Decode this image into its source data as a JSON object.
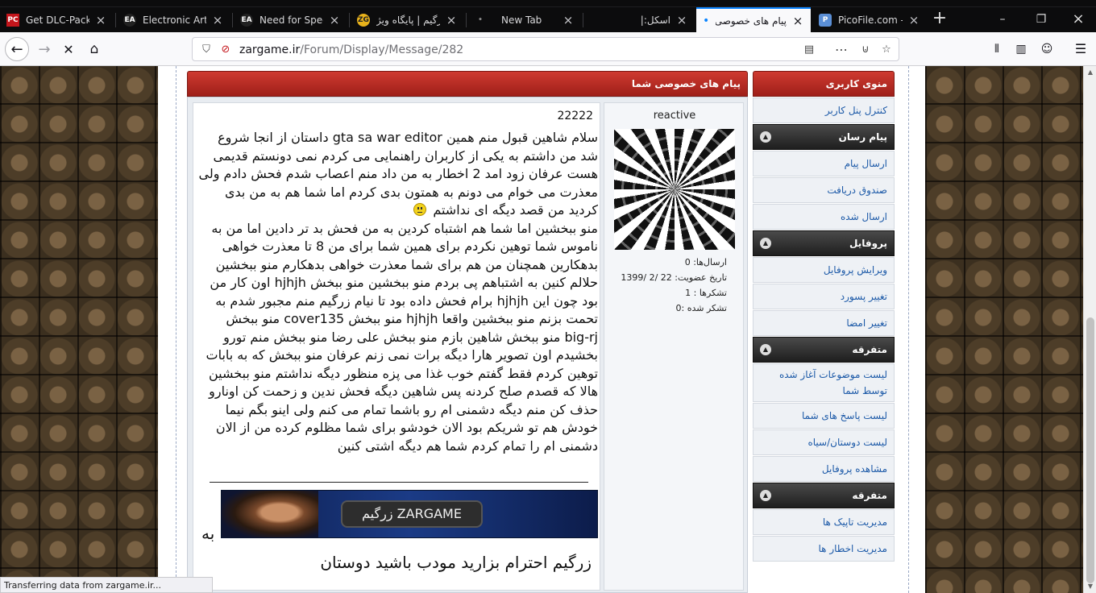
{
  "browser": {
    "tabs": [
      {
        "title": "Get DLC-Packed",
        "icon": "pc-icon",
        "icon_text": "PC"
      },
      {
        "title": "Electronic Arts",
        "icon": "ea-icon",
        "icon_text": "EA"
      },
      {
        "title": "Need for Speed",
        "icon": "ea-icon",
        "icon_text": "EA"
      },
      {
        "title": "زرگیم | پایگاه ویژ",
        "icon": "zargame-icon",
        "icon_text": "ZG"
      },
      {
        "title": "New Tab",
        "icon": "dot-icon",
        "icon_text": "•"
      },
      {
        "title": "اسکل:|",
        "icon": "blank-icon",
        "icon_text": ""
      },
      {
        "title": "پیام های خصوصی",
        "icon": "loading-dot-icon",
        "icon_text": "•",
        "active": true
      },
      {
        "title": "PicoFile.com - پ",
        "icon": "picofile-icon",
        "icon_text": "P"
      }
    ],
    "url_host": "zargame.ir",
    "url_path": "/Forum/Display/Message/282",
    "status_text": "Transferring data from zargame.ir..."
  },
  "sidebar": {
    "title": "منوی کاربری",
    "items_1": [
      "کنترل پنل کاربر"
    ],
    "section_messenger": "پیام رسان",
    "items_2": [
      "ارسال پیام",
      "صندوق دریافت",
      "ارسال شده"
    ],
    "section_profile": "پروفایل",
    "items_3": [
      "ویرایش پروفایل",
      "تغییر پسورد",
      "تغییر امضا"
    ],
    "section_misc_1": "متفرقه",
    "items_4": [
      "لیست موضوعات آغاز شده توسط شما",
      "لیست پاسخ های شما",
      "لیست دوستان/سیاه",
      "مشاهده پروفایل"
    ],
    "section_misc_2": "متفرقه",
    "items_5": [
      "مدیریت تاپیک ها",
      "مدیریت اخطار ها"
    ]
  },
  "main": {
    "header": "پیام های خصوصی شما",
    "user": {
      "name": "reactive",
      "posts": "ارسال‌ها: 0",
      "joined": "تاریخ عضویت: 22 /2 /1399",
      "thanks_given": "تشکرها : 1",
      "thanked": "تشکر شده :0"
    },
    "message": {
      "title": "22222",
      "para1": "سلام شاهین قبول منم همین gta sa war editor داستان از انجا شروع شد من داشتم به یکی از کاربران راهنمایی می کردم نمی دونستم قدیمی هست عرفان زود امد 2 اخطار به من داد منم اعصاب شدم فحش دادم ولی معذرت می خوام می دونم به همتون بدی کردم اما شما هم به من بدی کردید من قصد دیگه ای نداشتم",
      "para2": "منو ببخشین اما شما هم اشتباه کردین به من فحش بد تر دادین اما من به ناموس شما توهین نکردم برای همین شما برای من 8 تا معذرت خواهی بدهکارین همچنان من هم برای شما معذرت خواهی بدهکارم منو ببخشین حلالم کنین به اشتباهم پی بردم منو ببخشین منو ببخش hjhjh اون کار من بود چون این hjhjh برام فحش داده بود تا نیام زرگیم منم مجبور شدم به تحمت بزنم منو ببخشین واقعا hjhjh منو ببخش cover135 منو ببخش big-rj منو ببخش شاهین بازم منو ببخش علی رضا منو ببخش منم تورو بخشیدم اون تصویر هارا دیگه برات نمی زنم عرفان منو ببخش که به بابات توهین کردم فقط گفتم خوب غذا می پزه منظور دیگه نداشتم منو ببخشین",
      "para3": "هالا که قصدم صلح کردنه پس شاهین دیگه فحش ندین و زحمت کن اونارو حذف کن منم دیگه دشمنی ام رو باشما تمام می کنم ولی اینو بگم نیما خودش هم تو شریکم بود الان خودشو برای شما مظلوم کرده من از الان دشمنی ام را تمام کردم شما هم دیگه اشتی کنین",
      "signature_logo": "زرگیم ZARGAME",
      "signature_be": "به",
      "signature_text": "زرگیم احترام بزارید مودب باشید دوستان"
    }
  }
}
